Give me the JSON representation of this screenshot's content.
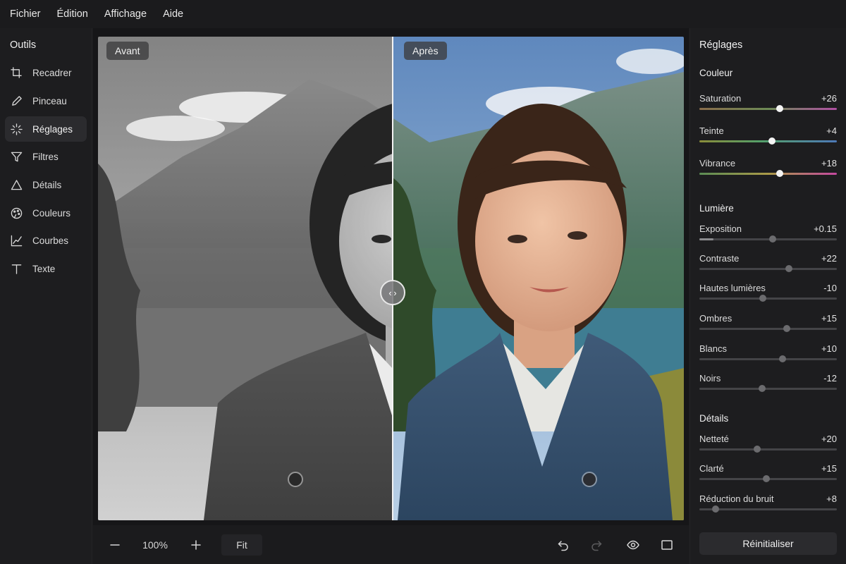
{
  "menu": [
    "Fichier",
    "Édition",
    "Affichage",
    "Aide"
  ],
  "tools": {
    "title": "Outils",
    "items": [
      {
        "label": "Recadrer",
        "icon": "crop-icon"
      },
      {
        "label": "Pinceau",
        "icon": "brush-icon"
      },
      {
        "label": "Réglages",
        "icon": "sparkle-icon",
        "active": true
      },
      {
        "label": "Filtres",
        "icon": "filter-icon"
      },
      {
        "label": "Détails",
        "icon": "triangle-icon"
      },
      {
        "label": "Couleurs",
        "icon": "palette-icon"
      },
      {
        "label": "Courbes",
        "icon": "curves-icon"
      },
      {
        "label": "Texte",
        "icon": "text-icon"
      }
    ]
  },
  "canvas": {
    "before_label": "Avant",
    "after_label": "Après",
    "split_position": 0.503
  },
  "bottom": {
    "zoom": "100%",
    "fit_label": "Fit"
  },
  "adjust": {
    "title": "Réglages",
    "sections": [
      {
        "title": "Couleur",
        "sliders": [
          {
            "label": "Saturation",
            "value": "+26",
            "pos": 0.585,
            "gradient": "sat"
          },
          {
            "label": "Teinte",
            "value": "+4",
            "pos": 0.53,
            "gradient": "hue"
          },
          {
            "label": "Vibrance",
            "value": "+18",
            "pos": 0.585,
            "gradient": "vib"
          }
        ]
      },
      {
        "title": "Lumière",
        "sliders": [
          {
            "label": "Exposition",
            "value": "+0.15",
            "pos": 0.535
          },
          {
            "label": "Contraste",
            "value": "+22",
            "pos": 0.65
          },
          {
            "label": "Hautes lumières",
            "value": "-10",
            "pos": 0.46
          },
          {
            "label": "Ombres",
            "value": "+15",
            "pos": 0.635
          },
          {
            "label": "Blancs",
            "value": "+10",
            "pos": 0.605
          },
          {
            "label": "Noirs",
            "value": "-12",
            "pos": 0.455
          }
        ]
      },
      {
        "title": "Détails",
        "sliders": [
          {
            "label": "Netteté",
            "value": "+20",
            "pos": 0.42
          },
          {
            "label": "Clarté",
            "value": "+15",
            "pos": 0.485
          },
          {
            "label": "Réduction du bruit",
            "value": "+8",
            "pos": 0.12
          }
        ]
      }
    ],
    "reset_label": "Réinitialiser"
  }
}
